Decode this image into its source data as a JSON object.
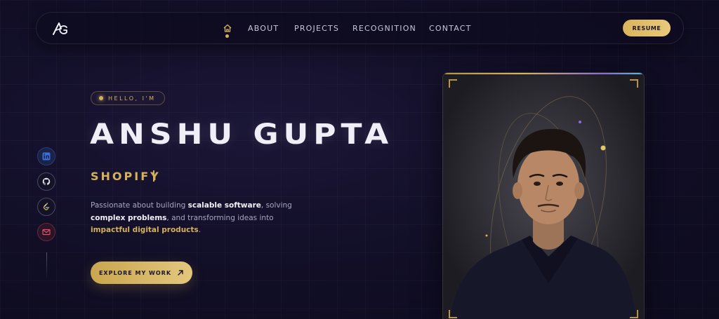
{
  "nav": {
    "logo_text": "AG",
    "home_icon": "home-icon",
    "links": [
      "ABOUT",
      "PROJECTS",
      "RECOGNITION",
      "CONTACT"
    ],
    "resume_label": "RESUME"
  },
  "social": {
    "icons": [
      "linkedin-icon",
      "github-icon",
      "leetcode-icon",
      "mail-icon"
    ]
  },
  "hero": {
    "greeting": "HELLO, I'M",
    "name": "ANSHU GUPTA",
    "role": "SHOPIFY",
    "description": {
      "p1": "Passionate about building ",
      "b1": "scalable software",
      "p2": ", solving ",
      "b2": "complex problems",
      "p3": ", and transforming ideas into ",
      "g1": "impactful digital products",
      "p4": "."
    },
    "cta_label": "EXPLORE MY WORK"
  },
  "colors": {
    "accent_gold": "#d6b15a",
    "background": "#110e26",
    "accent_purple": "#8a6cd9"
  }
}
